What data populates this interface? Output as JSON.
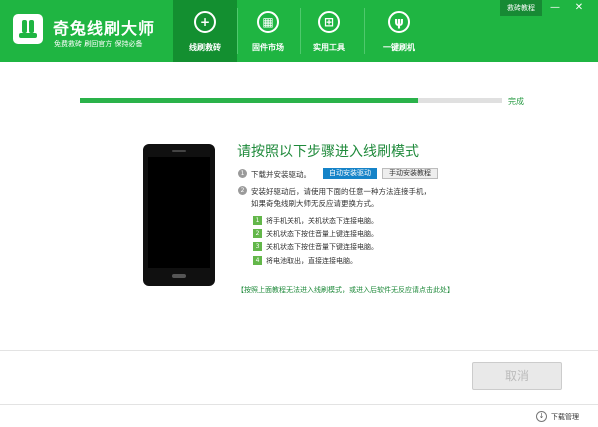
{
  "app": {
    "title": "奇兔线刷大师",
    "tagline": "免费救砖  刷回官方  保持必备",
    "brand_color": "#1fb542"
  },
  "nav": {
    "tabs": [
      {
        "label": "线刷救砖",
        "icon": "plus-icon",
        "active": true
      },
      {
        "label": "固件市场",
        "icon": "market-icon",
        "active": false
      },
      {
        "label": "实用工具",
        "icon": "grid-icon",
        "active": false
      },
      {
        "label": "一键刷机",
        "icon": "rabbit-icon",
        "active": false
      }
    ]
  },
  "window": {
    "tutorial_label": "救砖教程",
    "minimize_glyph": "—",
    "close_glyph": "✕"
  },
  "progress": {
    "fraction": 0.8,
    "label": "完成"
  },
  "instructions": {
    "title": "请按照以下步骤进入线刷模式",
    "steps": [
      {
        "num": "1",
        "text": "下载并安装驱动。"
      },
      {
        "num": "2",
        "text": "安装好驱动后，请使用下面的任意一种方法连接手机，",
        "text2": "如果奇兔线刷大师无反应请更换方式。"
      }
    ],
    "auto_install_label": "自动安装驱动",
    "manual_tutorial_label": "手动安装教程",
    "methods": [
      {
        "num": "1",
        "text": "将手机关机，关机状态下连接电脑。"
      },
      {
        "num": "2",
        "text": "关机状态下按住音量上键连接电脑。"
      },
      {
        "num": "3",
        "text": "关机状态下按住音量下键连接电脑。"
      },
      {
        "num": "4",
        "text": "将电池取出，直接连接电脑。"
      }
    ],
    "note": "【按照上面教程无法进入线刷模式，或进入后软件无反应请点击此处】"
  },
  "footer": {
    "cancel_label": "取消",
    "download_manager_label": "下载管理"
  }
}
